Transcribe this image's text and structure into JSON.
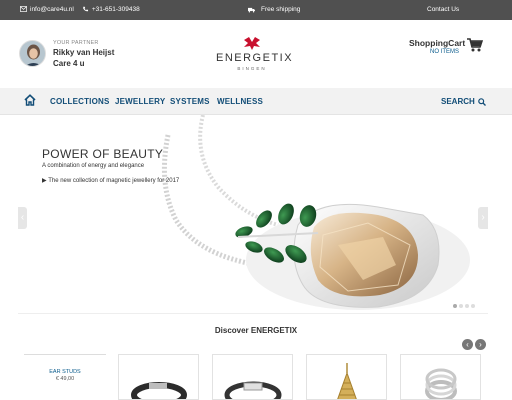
{
  "topbar": {
    "email": "info@care4u.nl",
    "phone": "+31-651-309438",
    "shipping": "Free shipping",
    "contact": "Contact Us"
  },
  "partner": {
    "tag": "YOUR PARTNER",
    "name": "Rikky van Heijst",
    "company": "Care 4 u"
  },
  "logo": {
    "word": "ENERGETIX",
    "sub": "BINGEN"
  },
  "cart": {
    "title": "ShoppingCart",
    "status": "NO ITEMS"
  },
  "nav": {
    "items": [
      "COLLECTIONS",
      "JEWELLERY",
      "SYSTEMS",
      "WELLNESS"
    ],
    "search": "SEARCH"
  },
  "hero": {
    "title": "POWER OF BEAUTY",
    "subtitle": "A combination of energy and elegance",
    "link": "The new collection of magnetic jewellery for 2017",
    "slides": 4,
    "active_slide": 1
  },
  "discover": {
    "title": "Discover ENERGETIX"
  },
  "products": [
    {
      "name": "EAR STUDS",
      "price": "€ 49,00"
    },
    {
      "name": "",
      "price": ""
    },
    {
      "name": "",
      "price": ""
    },
    {
      "name": "",
      "price": ""
    },
    {
      "name": "",
      "price": ""
    }
  ],
  "colors": {
    "topbar": "#505050",
    "nav_text": "#124d77",
    "accent_red": "#c8102e",
    "link_blue": "#0a5b8c"
  }
}
